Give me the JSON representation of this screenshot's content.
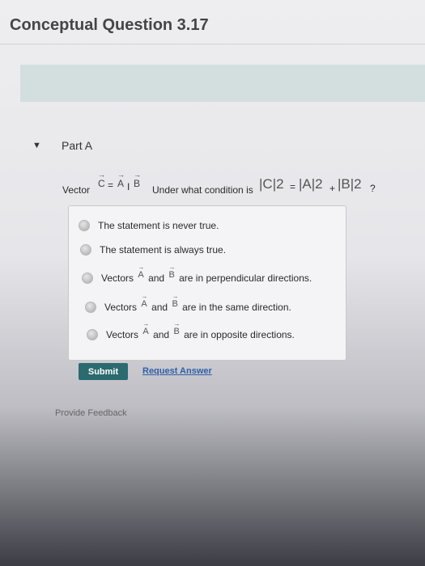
{
  "page": {
    "title": "Conceptual Question 3.17"
  },
  "part": {
    "label": "Part A",
    "toggle_icon": "▼"
  },
  "question": {
    "prefix": "Vector",
    "vec_c": "C",
    "eq1": "=",
    "vec_a": "A",
    "op": "I",
    "vec_b": "B",
    "mid": "Under what condition is",
    "cond_c": "|C|2",
    "cond_eq": "=",
    "cond_a": "|A|2",
    "cond_plus": "+",
    "cond_b": "|B|2",
    "cond_q": "?"
  },
  "options": [
    {
      "text": "The statement is never true."
    },
    {
      "text": "The statement is always true."
    },
    {
      "pre": "Vectors",
      "a": "A",
      "and": "and",
      "b": "B",
      "post": "are in perpendicular directions."
    },
    {
      "pre": "Vectors",
      "a": "A",
      "and": "and",
      "b": "B",
      "post": "are in the same direction."
    },
    {
      "pre": "Vectors",
      "a": "A",
      "and": "and",
      "b": "B",
      "post": "are in opposite directions."
    }
  ],
  "actions": {
    "submit_label": "Submit",
    "request_label": "Request Answer"
  },
  "footer": {
    "feedback_label": "Provide Feedback"
  },
  "colors": {
    "accent": "#2b6a6e",
    "link": "#2f5fa6",
    "banner": "#d3dfdf"
  }
}
